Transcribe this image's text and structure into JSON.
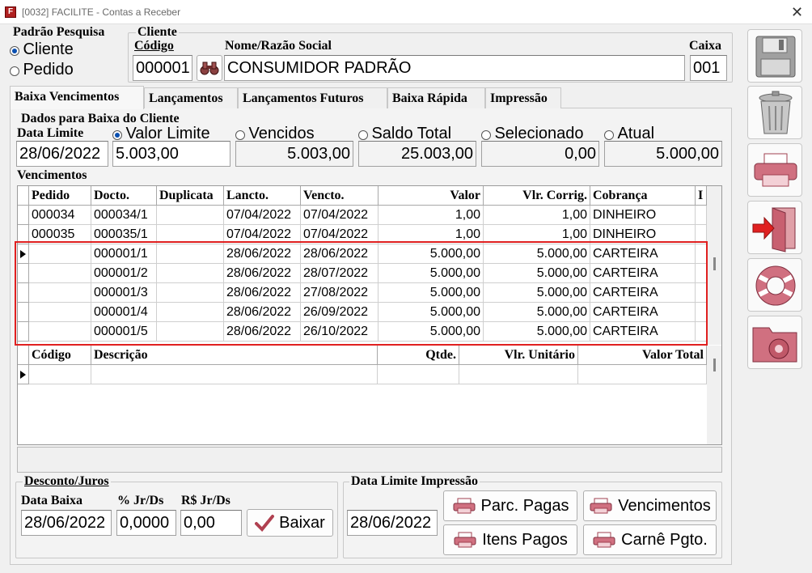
{
  "window": {
    "title": "[0032] FACILITE - Contas a Receber",
    "close_symbol": "✕",
    "app_icon_letter": "F"
  },
  "padrao_pesquisa": {
    "label": "Padrão Pesquisa",
    "options": [
      "Cliente",
      "Pedido"
    ],
    "selected": "Cliente"
  },
  "cliente": {
    "group_label": "Cliente",
    "codigo_label": "Código",
    "codigo_value": "000001",
    "nome_label": "Nome/Razão Social",
    "nome_value": "CONSUMIDOR PADRÃO",
    "caixa_label": "Caixa",
    "caixa_value": "001"
  },
  "tabs": [
    "Baixa Vencimentos",
    "Lançamentos",
    "Lançamentos Futuros",
    "Baixa Rápida",
    "Impressão"
  ],
  "active_tab": "Baixa Vencimentos",
  "dados": {
    "group_label": "Dados para Baixa do Cliente",
    "data_limite_label": "Data Limite",
    "data_limite_value": "28/06/2022",
    "options": [
      {
        "label": "Valor Limite",
        "value": "5.003,00",
        "selected": true
      },
      {
        "label": "Vencidos",
        "value": "5.003,00",
        "selected": false
      },
      {
        "label": "Saldo Total",
        "value": "25.003,00",
        "selected": false
      },
      {
        "label": "Selecionado",
        "value": "0,00",
        "selected": false
      },
      {
        "label": "Atual",
        "value": "5.000,00",
        "selected": false
      }
    ]
  },
  "vencimentos": {
    "label": "Vencimentos",
    "columns": [
      "Pedido",
      "Docto.",
      "Duplicata",
      "Lancto.",
      "Vencto.",
      "Valor",
      "Vlr. Corrig.",
      "Cobrança",
      "I"
    ],
    "rows": [
      [
        "000034",
        "000034/1",
        "",
        "07/04/2022",
        "07/04/2022",
        "1,00",
        "1,00",
        "DINHEIRO"
      ],
      [
        "000035",
        "000035/1",
        "",
        "07/04/2022",
        "07/04/2022",
        "1,00",
        "1,00",
        "DINHEIRO"
      ],
      [
        "",
        "000001/1",
        "",
        "28/06/2022",
        "28/06/2022",
        "5.000,00",
        "5.000,00",
        "CARTEIRA"
      ],
      [
        "",
        "000001/2",
        "",
        "28/06/2022",
        "28/07/2022",
        "5.000,00",
        "5.000,00",
        "CARTEIRA"
      ],
      [
        "",
        "000001/3",
        "",
        "28/06/2022",
        "27/08/2022",
        "5.000,00",
        "5.000,00",
        "CARTEIRA"
      ],
      [
        "",
        "000001/4",
        "",
        "28/06/2022",
        "26/09/2022",
        "5.000,00",
        "5.000,00",
        "CARTEIRA"
      ],
      [
        "",
        "000001/5",
        "",
        "28/06/2022",
        "26/10/2022",
        "5.000,00",
        "5.000,00",
        "CARTEIRA"
      ]
    ],
    "current_row": 2
  },
  "itens": {
    "columns": [
      "Código",
      "Descrição",
      "Qtde.",
      "Vlr. Unitário",
      "Valor Total"
    ]
  },
  "desconto": {
    "group_label": "Desconto/Juros",
    "data_baixa_label": "Data Baixa",
    "data_baixa_value": "28/06/2022",
    "jr_pct_label": "% Jr/Ds",
    "jr_pct_value": "0,0000",
    "jr_rs_label": "R$ Jr/Ds",
    "jr_rs_value": "0,00",
    "baixar_label": "Baixar"
  },
  "impressao": {
    "group_label": "Data Limite Impressão",
    "date_value": "28/06/2022",
    "buttons": [
      "Parc. Pagas",
      "Vencimentos",
      "Itens Pagos",
      "Carnê Pgto."
    ]
  },
  "sidebar": [
    "save-icon",
    "trash-icon",
    "printer-icon",
    "exit-door-icon",
    "lifebuoy-icon",
    "folder-gear-icon"
  ],
  "colors": {
    "highlight_box": "#e02020",
    "radio_selected": "#0a4fb0",
    "accent_icon": "#c86070"
  }
}
